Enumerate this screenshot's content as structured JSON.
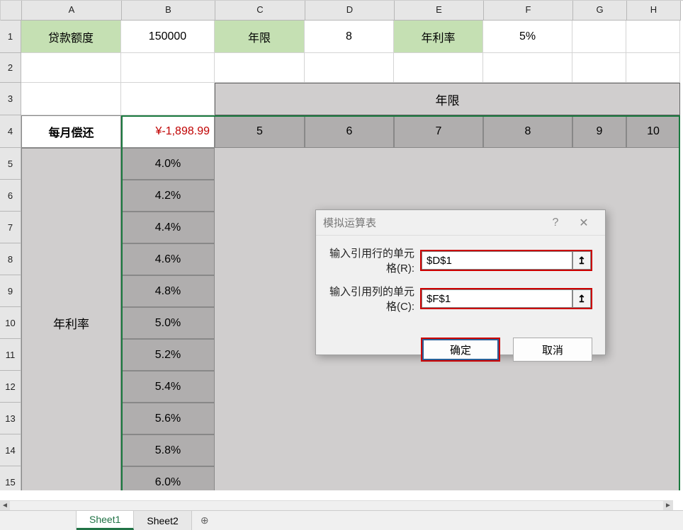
{
  "columns": [
    "A",
    "B",
    "C",
    "D",
    "E",
    "F",
    "G",
    "H"
  ],
  "row_labels": [
    "1",
    "2",
    "3",
    "4",
    "5",
    "6",
    "7",
    "8",
    "9",
    "10",
    "11",
    "12",
    "13",
    "14",
    "15"
  ],
  "row1": {
    "a": "贷款额度",
    "b": "150000",
    "c": "年限",
    "d": "8",
    "e": "年利率",
    "f": "5%"
  },
  "row3": {
    "header": "年限"
  },
  "row4": {
    "a": "每月偿还",
    "b": "¥-1,898.99",
    "years": [
      "5",
      "6",
      "7",
      "8",
      "9",
      "10"
    ]
  },
  "col_b_rates": [
    "4.0%",
    "4.2%",
    "4.4%",
    "4.6%",
    "4.8%",
    "5.0%",
    "5.2%",
    "5.4%",
    "5.6%",
    "5.8%",
    "6.0%"
  ],
  "left_label": "年利率",
  "dialog": {
    "title": "模拟运算表",
    "help": "?",
    "close": "✕",
    "row_label": "输入引用行的单元格(R):",
    "col_label": "输入引用列的单元格(C):",
    "row_input": "$D$1",
    "col_input": "$F$1",
    "ok": "确定",
    "cancel": "取消",
    "range_icon": "↥"
  },
  "sheets": {
    "active": "Sheet1",
    "tabs": [
      "Sheet1",
      "Sheet2"
    ],
    "add": "⊕"
  }
}
